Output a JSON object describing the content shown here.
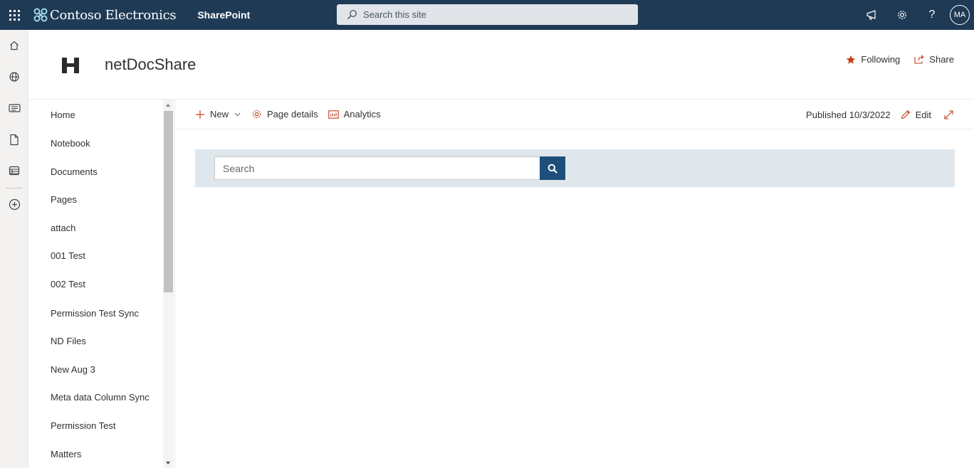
{
  "suitebar": {
    "brand_name": "Contoso Electronics",
    "app_name": "SharePoint",
    "search_placeholder": "Search this site",
    "avatar_initials": "MA"
  },
  "site": {
    "logo_letter": "H",
    "title": "netDocShare",
    "following_label": "Following",
    "share_label": "Share"
  },
  "nav": {
    "items": [
      {
        "label": "Home"
      },
      {
        "label": "Notebook"
      },
      {
        "label": "Documents"
      },
      {
        "label": "Pages"
      },
      {
        "label": "attach"
      },
      {
        "label": "001 Test"
      },
      {
        "label": "002 Test"
      },
      {
        "label": "Permission Test Sync"
      },
      {
        "label": "ND Files"
      },
      {
        "label": "New Aug 3"
      },
      {
        "label": "Meta data Column Sync"
      },
      {
        "label": "Permission Test"
      },
      {
        "label": "Matters"
      }
    ]
  },
  "commandbar": {
    "new_label": "New",
    "page_details_label": "Page details",
    "analytics_label": "Analytics",
    "published_label": "Published 10/3/2022",
    "edit_label": "Edit"
  },
  "search_webpart": {
    "placeholder": "Search"
  },
  "colors": {
    "suitebar_bg": "#1f3a55",
    "search_band_bg": "#dfe7ec",
    "search_button_bg": "#1e4f7a",
    "accent_orange": "#c43e1c"
  }
}
